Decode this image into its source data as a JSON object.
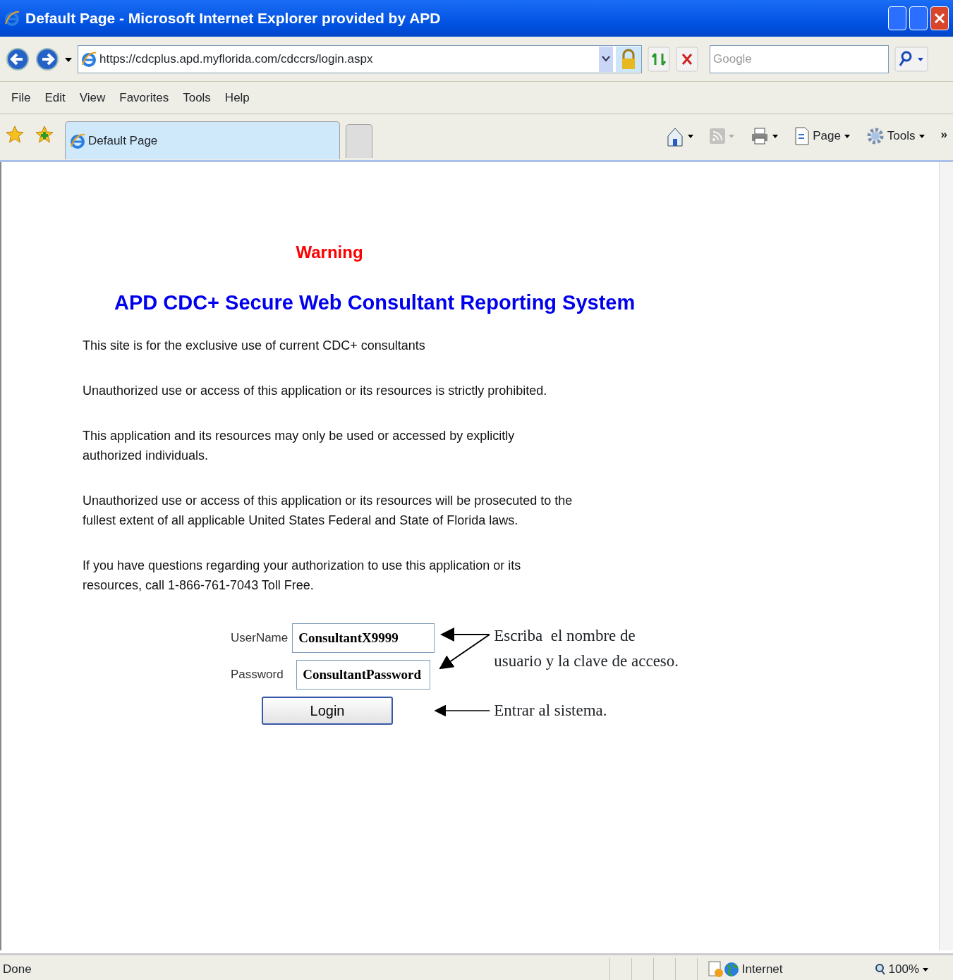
{
  "window": {
    "title": "Default Page - Microsoft Internet Explorer provided by APD"
  },
  "address_bar": {
    "url": "https://cdcplus.apd.myflorida.com/cdccrs/login.aspx"
  },
  "search": {
    "placeholder": "Google"
  },
  "menu": [
    "File",
    "Edit",
    "View",
    "Favorites",
    "Tools",
    "Help"
  ],
  "tabs": [
    {
      "label": "Default Page",
      "selected": true
    }
  ],
  "command_bar": {
    "items": [
      {
        "kind": "home",
        "disabled": false
      },
      {
        "kind": "feed",
        "disabled": true
      },
      {
        "kind": "print",
        "disabled": false
      },
      {
        "kind": "page",
        "label": "Page",
        "disabled": false
      },
      {
        "kind": "tools",
        "label": "Tools",
        "disabled": false
      }
    ],
    "overflow": "»"
  },
  "page": {
    "warning": "Warning",
    "heading": "APD CDC+ Secure Web Consultant Reporting System",
    "paragraphs": [
      "This site is for the exclusive use of current CDC+ consultants",
      "Unauthorized use or access of this application or its resources is strictly prohibited.",
      "This application and its resources may only be used or accessed by explicitly authorized individuals.",
      "Unauthorized use or access of this application or its resources will be prosecuted to the fullest extent of all applicable United States Federal and State of Florida laws.",
      "If you have questions regarding your authorization to use this application or its resources, call 1-866-761-7043 Toll Free."
    ],
    "form": {
      "fields": [
        {
          "label": "UserName",
          "value": "ConsultantX9999"
        },
        {
          "label": "Password",
          "value": "ConsultantPassword"
        }
      ],
      "button": "Login"
    },
    "annotations": [
      "Escriba  el nombre de\nusuario y la clave de acceso.",
      "Entrar al sistema."
    ]
  },
  "status_bar": {
    "text": "Done",
    "zone": "Internet",
    "zoom": "100%"
  }
}
